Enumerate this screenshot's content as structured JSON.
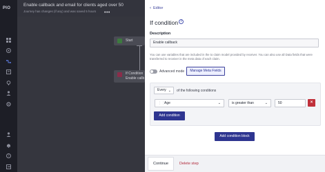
{
  "app": {
    "logo": "PIO"
  },
  "rail": {
    "icons": [
      "grid-icon",
      "broadcast-icon",
      "journey-icon",
      "template-icon",
      "location-icon",
      "users-icon",
      "settings-icon",
      "team-icon",
      "bell-icon",
      "help-icon",
      "logout-icon"
    ]
  },
  "background": {
    "title": "Enable callback and email for clients aged over 50",
    "subtitle": "Journey has changes (if any) and was saved 5 hours",
    "menu_dots": "•••",
    "nodes": {
      "start": "Start",
      "if_line1": "If Condition",
      "if_line2": "Enable callb"
    }
  },
  "panel": {
    "back_label": "Editor",
    "title": "If condition",
    "description_label": "Description",
    "description_value": "Enable callback",
    "hint": "You can use variables that are included in the to claim model provided by receiver. You can also use all Data fields that were transferred to receiver in the meta data of each claim.",
    "advanced_mode_label": "Advanced mode",
    "advanced_mode_on": false,
    "manage_meta_fields_label": "Manage Meta Fields",
    "conditions": {
      "quantifier": "Every",
      "following_label": "of the following conditions",
      "rows": [
        {
          "field": "Age",
          "operator": "is greater than",
          "value": "50"
        }
      ],
      "add_condition_label": "Add condition"
    },
    "add_condition_block_label": "Add condition block",
    "continue_label": "Continue",
    "delete_step_label": "Delete step"
  },
  "colors": {
    "primary": "#2e3590",
    "danger": "#c0303a",
    "overlay": "#3a3b44"
  }
}
